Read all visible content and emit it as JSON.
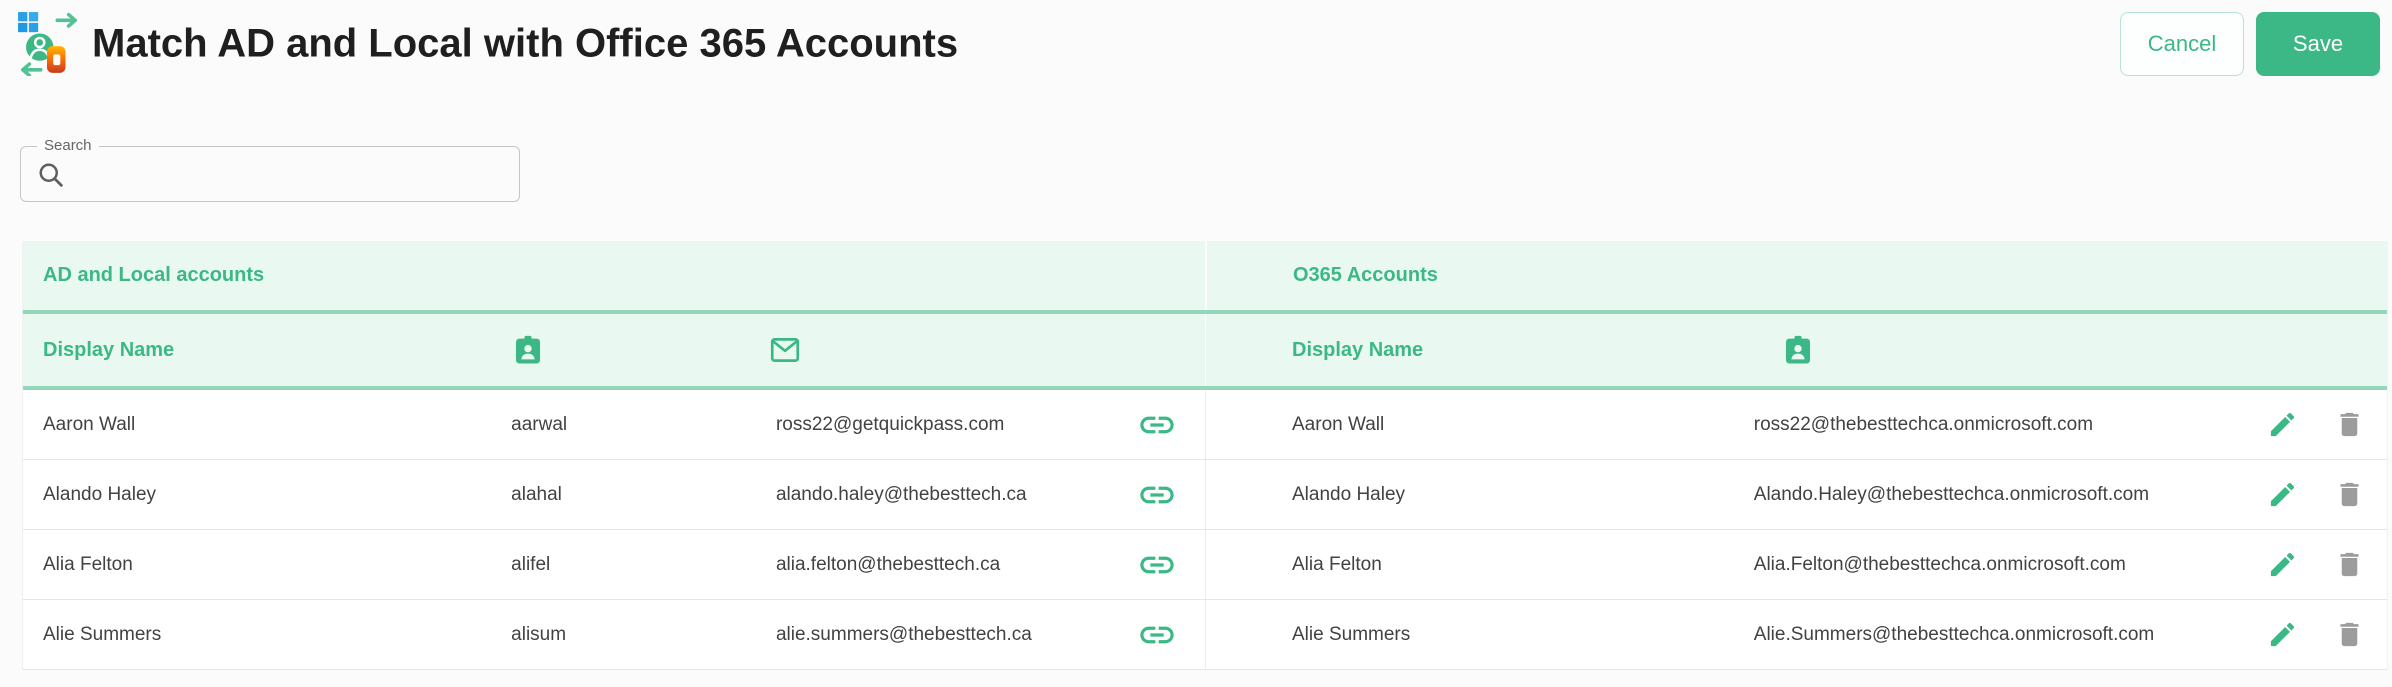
{
  "theme": {
    "accent": "#3cb886",
    "accent_soft": "#92d7ba",
    "mint_bg": "#e9f8f1"
  },
  "header": {
    "icon": "ad-local-o365-sync-icon",
    "title": "Match AD and Local with Office 365 Accounts",
    "cancel_label": "Cancel",
    "save_label": "Save"
  },
  "search": {
    "label": "Search",
    "value": "",
    "icon": "search-icon"
  },
  "table": {
    "left_section_title": "AD and Local accounts",
    "right_section_title": "O365 Accounts",
    "left_columns": {
      "display_name": "Display Name",
      "username_icon": "badge-icon",
      "email_icon": "mail-icon"
    },
    "right_columns": {
      "display_name": "Display Name",
      "username_icon": "badge-icon"
    },
    "row_icons": {
      "link": "link-icon",
      "edit": "edit-pencil-icon",
      "delete": "trash-icon"
    },
    "rows": [
      {
        "local_name": "Aaron Wall",
        "username": "aarwal",
        "local_email": "ross22@getquickpass.com",
        "o365_name": "Aaron Wall",
        "o365_email": "ross22@thebesttechca.onmicrosoft.com"
      },
      {
        "local_name": "Alando Haley",
        "username": "alahal",
        "local_email": "alando.haley@thebesttech.ca",
        "o365_name": "Alando Haley",
        "o365_email": "Alando.Haley@thebesttechca.onmicrosoft.com"
      },
      {
        "local_name": "Alia Felton",
        "username": "alifel",
        "local_email": "alia.felton@thebesttech.ca",
        "o365_name": "Alia Felton",
        "o365_email": "Alia.Felton@thebesttechca.onmicrosoft.com"
      },
      {
        "local_name": "Alie Summers",
        "username": "alisum",
        "local_email": "alie.summers@thebesttech.ca",
        "o365_name": "Alie Summers",
        "o365_email": "Alie.Summers@thebesttechca.onmicrosoft.com"
      }
    ]
  }
}
